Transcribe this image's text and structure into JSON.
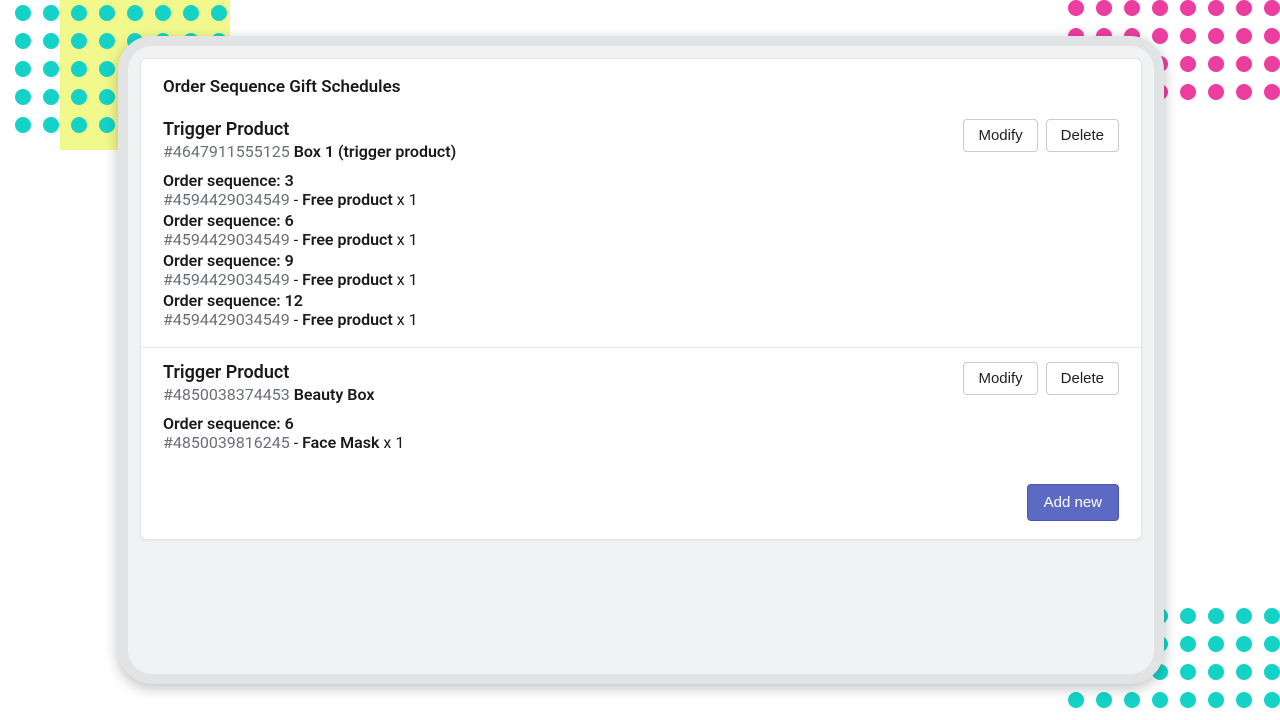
{
  "page": {
    "title": "Order Sequence Gift Schedules",
    "add_new_label": "Add new"
  },
  "buttons": {
    "modify": "Modify",
    "delete": "Delete"
  },
  "labels": {
    "trigger_product": "Trigger Product",
    "order_sequence_prefix": "Order sequence: "
  },
  "schedules": [
    {
      "trigger_id": "#4647911555125",
      "trigger_name": "Box 1 (trigger product)",
      "sequences": [
        {
          "seq": "3",
          "items": [
            {
              "product_id": "#4594429034549",
              "product_name": "Free product",
              "qty": "1"
            }
          ]
        },
        {
          "seq": "6",
          "items": [
            {
              "product_id": "#4594429034549",
              "product_name": "Free product",
              "qty": "1"
            }
          ]
        },
        {
          "seq": "9",
          "items": [
            {
              "product_id": "#4594429034549",
              "product_name": "Free product",
              "qty": "1"
            }
          ]
        },
        {
          "seq": "12",
          "items": [
            {
              "product_id": "#4594429034549",
              "product_name": "Free product",
              "qty": "1"
            }
          ]
        }
      ]
    },
    {
      "trigger_id": "#4850038374453",
      "trigger_name": "Beauty Box",
      "sequences": [
        {
          "seq": "6",
          "items": [
            {
              "product_id": "#4850039816245",
              "product_name": "Face Mask",
              "qty": "1"
            }
          ]
        }
      ]
    }
  ],
  "colors": {
    "primary": "#5c6ac4",
    "teal": "#14d3c6",
    "pink": "#ec3e9e",
    "yellow": "#f2f98c"
  }
}
